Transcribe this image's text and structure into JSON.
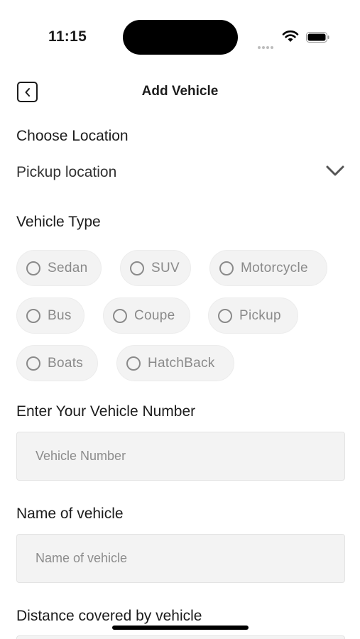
{
  "status_bar": {
    "time": "11:15"
  },
  "header": {
    "title": "Add Vehicle"
  },
  "location": {
    "label": "Choose Location",
    "value": "Pickup location"
  },
  "vehicle_type": {
    "label": "Vehicle Type",
    "options": [
      "Sedan",
      "SUV",
      "Motorcycle",
      "Bus",
      "Coupe",
      "Pickup",
      "Boats",
      "HatchBack"
    ]
  },
  "vehicle_number": {
    "label": "Enter Your Vehicle Number",
    "placeholder": "Vehicle Number"
  },
  "vehicle_name": {
    "label": "Name of vehicle",
    "placeholder": "Name of vehicle"
  },
  "distance": {
    "label": "Distance covered by vehicle"
  }
}
